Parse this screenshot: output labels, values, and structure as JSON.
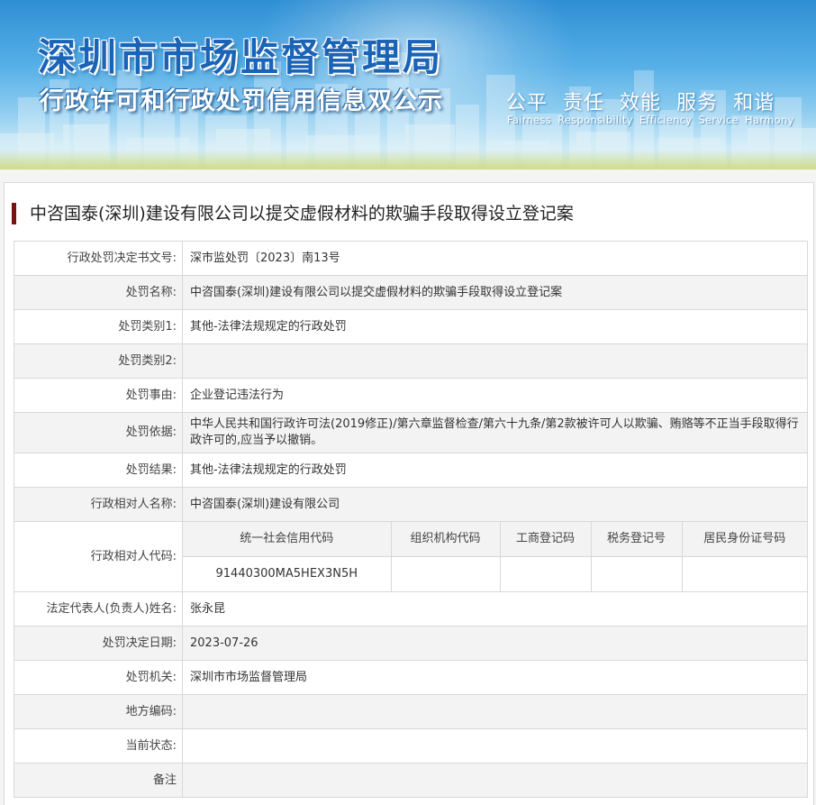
{
  "header": {
    "title": "深圳市市场监督管理局",
    "subtitle": "行政许可和行政处罚信用信息双公示",
    "slogan_cn": [
      "公平",
      "责任",
      "效能",
      "服务",
      "和谐"
    ],
    "slogan_en": [
      "Fairness",
      "Responsibility",
      "Efficiency",
      "Service",
      "Harmony"
    ]
  },
  "case": {
    "title": "中咨国泰(深圳)建设有限公司以提交虚假材料的欺骗手段取得设立登记案"
  },
  "fields": {
    "decision_no": {
      "label": "行政处罚决定书文号:",
      "value": "深市监处罚〔2023〕南13号"
    },
    "penalty_name": {
      "label": "处罚名称:",
      "value": "中咨国泰(深圳)建设有限公司以提交虚假材料的欺骗手段取得设立登记案"
    },
    "category1": {
      "label": "处罚类别1:",
      "value": "其他-法律法规规定的行政处罚"
    },
    "category2": {
      "label": "处罚类别2:",
      "value": ""
    },
    "cause": {
      "label": "处罚事由:",
      "value": "企业登记违法行为"
    },
    "basis": {
      "label": "处罚依据:",
      "value": "中华人民共和国行政许可法(2019修正)/第六章监督检查/第六十九条/第2款被许可人以欺骗、贿赂等不正当手段取得行政许可的,应当予以撤销。"
    },
    "result": {
      "label": "处罚结果:",
      "value": "其他-法律法规规定的行政处罚"
    },
    "party_name": {
      "label": "行政相对人名称:",
      "value": "中咨国泰(深圳)建设有限公司"
    },
    "party_code": {
      "label": "行政相对人代码:",
      "headers": [
        "统一社会信用代码",
        "组织机构代码",
        "工商登记码",
        "税务登记号",
        "居民身份证号码"
      ],
      "values": [
        "91440300MA5HEX3N5H",
        "",
        "",
        "",
        ""
      ]
    },
    "legal_rep": {
      "label": "法定代表人(负责人)姓名:",
      "value": "张永昆"
    },
    "decision_date": {
      "label": "处罚决定日期:",
      "value": "2023-07-26"
    },
    "authority": {
      "label": "处罚机关:",
      "value": "深圳市市场监督管理局"
    },
    "region_code": {
      "label": "地方编码:",
      "value": ""
    },
    "status": {
      "label": "当前状态:",
      "value": ""
    },
    "remarks": {
      "label": "备注",
      "value": ""
    }
  }
}
